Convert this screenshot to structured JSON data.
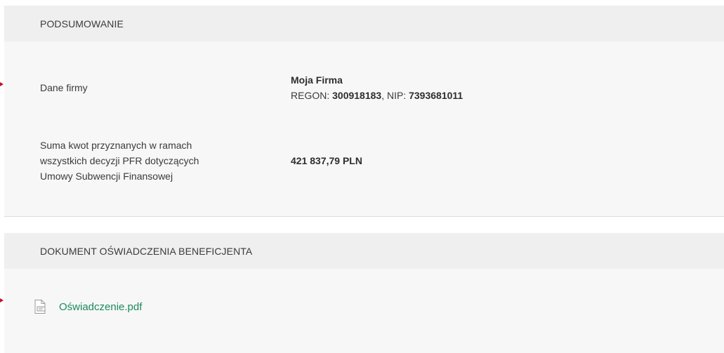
{
  "summary": {
    "header": "PODSUMOWANIE",
    "company": {
      "label": "Dane firmy",
      "name": "Moja Firma",
      "regon_label": "REGON: ",
      "regon": "300918183",
      "separator": ", NIP: ",
      "nip": "7393681011"
    },
    "sum": {
      "label_line1": "Suma kwot przyznanych w ramach",
      "label_line2": "wszystkich decyzji PFR dotyczących",
      "label_line3": "Umowy Subwencji Finansowej",
      "value": "421 837,79 PLN"
    }
  },
  "document": {
    "header": "DOKUMENT OŚWIADCZENIA BENEFICJENTA",
    "file": {
      "name": "Oświadczenie.pdf",
      "icon": "pdf-file-icon"
    }
  },
  "colors": {
    "link": "#1b8a5a",
    "marker": "#c8102e",
    "header_bg": "#efefef",
    "card_bg": "#f7f7f7"
  }
}
